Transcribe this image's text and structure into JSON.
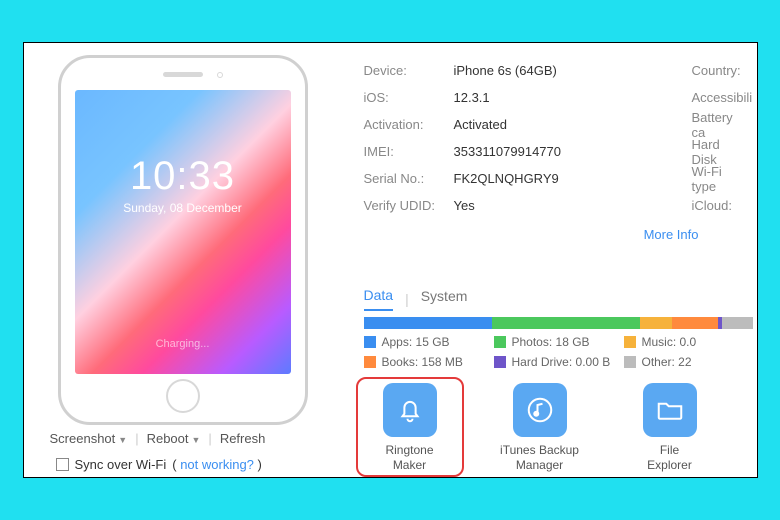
{
  "phone": {
    "time": "10:33",
    "date": "Sunday, 08 December",
    "status": "Charging..."
  },
  "controls": {
    "screenshot": "Screenshot",
    "reboot": "Reboot",
    "refresh": "Refresh"
  },
  "sync": {
    "label": "Sync over Wi-Fi",
    "hint_open": "(",
    "hint_link": "not working?",
    "hint_close": ")"
  },
  "info": {
    "rows": [
      {
        "label": "Device:",
        "value": "iPhone 6s   (64GB)",
        "label2": "Country:"
      },
      {
        "label": "iOS:",
        "value": "12.3.1",
        "label2": "Accessibili"
      },
      {
        "label": "Activation:",
        "value": "Activated",
        "label2": "Battery ca"
      },
      {
        "label": "IMEI:",
        "value": "353311079914770",
        "label2": "Hard Disk"
      },
      {
        "label": "Serial No.:",
        "value": "FK2QLNQHGRY9",
        "label2": "Wi-Fi type"
      },
      {
        "label": "Verify UDID:",
        "value": "Yes",
        "label2": "iCloud:"
      }
    ],
    "more": "More Info"
  },
  "tabs": {
    "data": "Data",
    "system": "System"
  },
  "storage": {
    "segments": [
      {
        "color": "#3a8ef0",
        "pct": 33
      },
      {
        "color": "#4bc85d",
        "pct": 38
      },
      {
        "color": "#f6b23b",
        "pct": 8
      },
      {
        "color": "#ff8a3d",
        "pct": 12
      },
      {
        "color": "#6e55c9",
        "pct": 1
      },
      {
        "color": "#bcbcbc",
        "pct": 8
      }
    ]
  },
  "legend": {
    "row1": [
      {
        "color": "#3a8ef0",
        "text": "Apps: 15 GB"
      },
      {
        "color": "#4bc85d",
        "text": "Photos: 18 GB"
      },
      {
        "color": "#f6b23b",
        "text": "Music: 0.0"
      }
    ],
    "row2": [
      {
        "color": "#ff8a3d",
        "text": "Books: 158 MB"
      },
      {
        "color": "#6e55c9",
        "text": "Hard Drive: 0.00 B"
      },
      {
        "color": "#bcbcbc",
        "text": "Other: 22"
      }
    ]
  },
  "tools": {
    "ringtone": {
      "line1": "Ringtone",
      "line2": "Maker"
    },
    "itunes": {
      "line1": "iTunes Backup",
      "line2": "Manager"
    },
    "files": {
      "line1": "File",
      "line2": "Explorer"
    }
  }
}
